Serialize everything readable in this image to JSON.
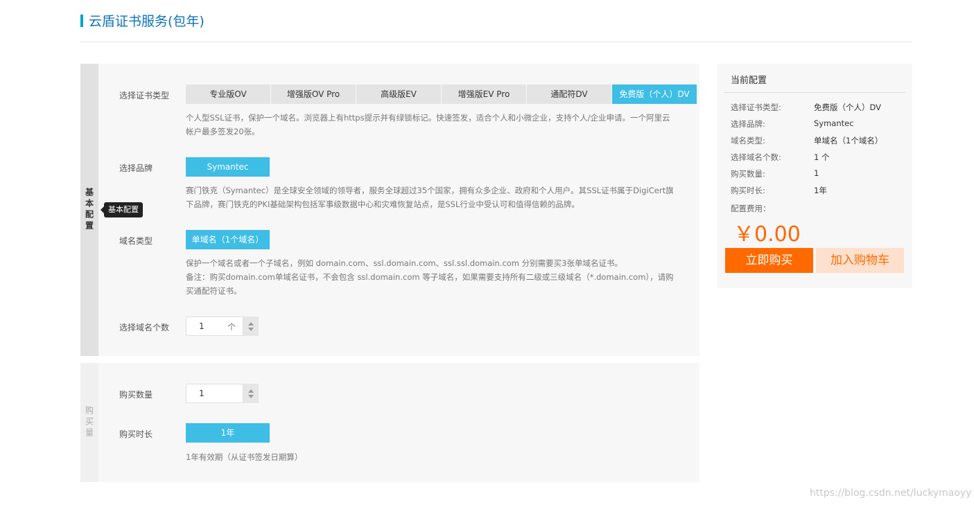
{
  "page": {
    "title": "云盾证书服务(包年)"
  },
  "basic_section": {
    "side_label": "基本配置",
    "tooltip": "基本配置",
    "cert_type": {
      "label": "选择证书类型",
      "tabs": [
        "专业版OV",
        "增强版OV Pro",
        "高级版EV",
        "增强版EV Pro",
        "通配符DV",
        "免费版（个人）DV"
      ],
      "selected_index": 5,
      "desc_line1": "个人型SSL证书，保护一个域名。浏览器上有https提示并有绿锁标记。快速签发，适合个人和小微企业，支持个人/企业申请。一个阿里云",
      "desc_line2": "帐户最多签发20张。"
    },
    "brand": {
      "label": "选择品牌",
      "value": "Symantec",
      "desc_line1": "赛门铁克（Symantec）是全球安全领域的领导者，服务全球超过35个国家，拥有众多企业、政府和个人用户。其SSL证书属于DigiCert旗",
      "desc_line2": "下品牌，赛门铁克的PKI基础架构包括军事级数据中心和灾难恢复站点，是SSL行业中受认可和值得信赖的品牌。"
    },
    "domain_type": {
      "label": "域名类型",
      "value": "单域名（1个域名）",
      "desc_line1": "保护一个域名或者一个子域名，例如 domain.com、ssl.domain.com、ssl.ssl.domain.com 分别需要买3张单域名证书。",
      "desc_line2": "备注：购买domain.com单域名证书，不会包含 ssl.domain.com 等子域名，如果需要支持所有二级或三级域名（*.domain.com），请购",
      "desc_line3": "买通配符证书。"
    },
    "domain_count": {
      "label": "选择域名个数",
      "value": "1",
      "unit": "个"
    }
  },
  "purchase_section": {
    "side_label": "购买量",
    "quantity": {
      "label": "购买数量",
      "value": "1"
    },
    "duration": {
      "label": "购买时长",
      "value": "1年",
      "desc": "1年有效期（从证书签发日期算）"
    }
  },
  "summary": {
    "title": "当前配置",
    "rows": [
      {
        "k": "选择证书类型:",
        "v": "免费版（个人）DV"
      },
      {
        "k": "选择品牌:",
        "v": "Symantec"
      },
      {
        "k": "域名类型:",
        "v": "单域名（1个域名）"
      },
      {
        "k": "选择域名个数:",
        "v": "1 个"
      },
      {
        "k": "购买数量:",
        "v": "1"
      },
      {
        "k": "购买时长:",
        "v": "1年"
      }
    ],
    "fee_label": "配置费用：",
    "price": "￥0.00",
    "buy_button": "立即购买",
    "cart_button": "加入购物车"
  },
  "watermark": "https://blog.csdn.net/luckymaoyy",
  "colors": {
    "accent": "#3ebde5",
    "title": "#0e74b8",
    "buy": "#ff6a00",
    "cart_bg": "#fde0cd"
  }
}
